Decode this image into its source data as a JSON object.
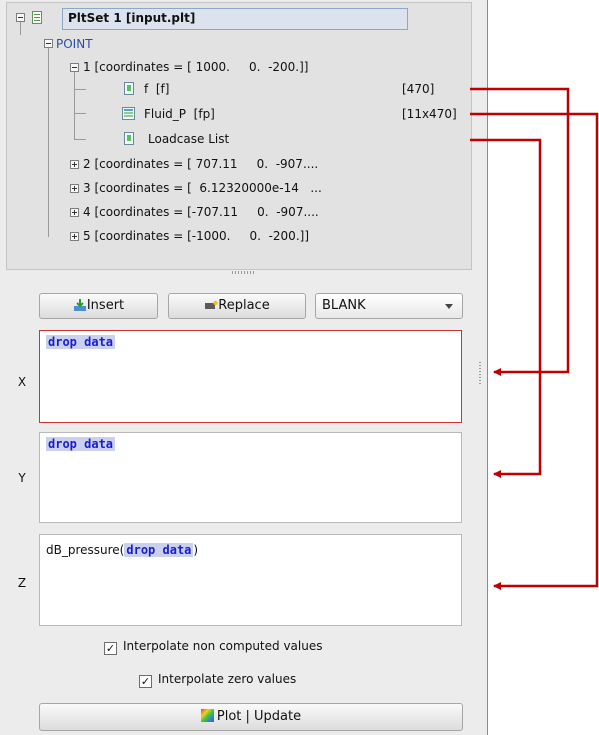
{
  "tree": {
    "root": {
      "label": "PltSet 1 [input.plt]"
    },
    "point_folder": {
      "label": "POINT"
    },
    "points": [
      {
        "label": "1 [coordinates = [ 1000.     0.  -200.]]",
        "expanded": true
      },
      {
        "label": "2 [coordinates = [ 707.11     0.  -907....",
        "expanded": false
      },
      {
        "label": "3 [coordinates = [  6.12320000e-14   ...",
        "expanded": false
      },
      {
        "label": "4 [coordinates = [-707.11     0.  -907....",
        "expanded": false
      },
      {
        "label": "5 [coordinates = [-1000.     0.  -200.]]",
        "expanded": false
      }
    ],
    "point1_children": [
      {
        "label": "f  [f]",
        "size": "[470]",
        "icon": "vector-icon"
      },
      {
        "label": "Fluid_P  [fp]",
        "size": "[11x470]",
        "icon": "matrix-icon"
      },
      {
        "label": "Loadcase List",
        "size": "",
        "icon": "vector-icon"
      }
    ]
  },
  "toolbar": {
    "insert_label": "Insert",
    "replace_label": "Replace",
    "blank_select_value": "BLANK"
  },
  "inputs": {
    "x": {
      "axis": "X",
      "prefix": "",
      "drop": "drop data",
      "suffix": ""
    },
    "y": {
      "axis": "Y",
      "prefix": "",
      "drop": "drop data",
      "suffix": ""
    },
    "z": {
      "axis": "Z",
      "prefix": "dB_pressure(",
      "drop": "drop data",
      "suffix": ")"
    }
  },
  "options": {
    "interpolate_non_computed": {
      "label": "Interpolate non computed values",
      "checked": true
    },
    "interpolate_zero": {
      "label": "Interpolate zero values",
      "checked": true
    }
  },
  "plot_button_label": "Plot | Update",
  "colors": {
    "arrow": "#c00000",
    "drop_text": "#1c1ccc",
    "drop_bg": "#c9d1ee",
    "active_border": "#cc3333"
  }
}
